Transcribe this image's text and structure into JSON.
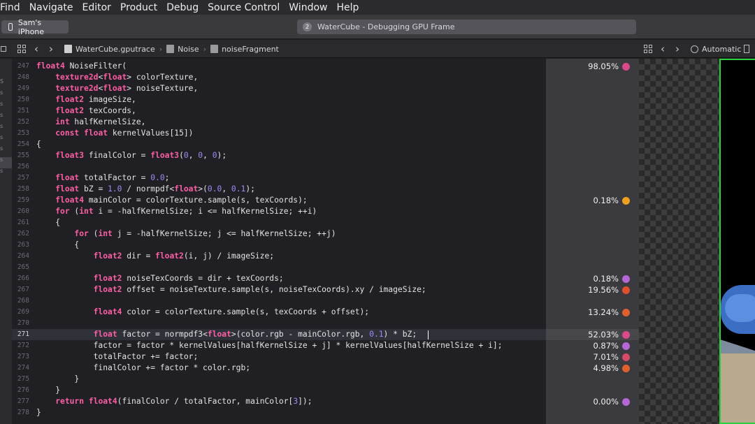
{
  "menu": [
    "Find",
    "Navigate",
    "Editor",
    "Product",
    "Debug",
    "Source Control",
    "Window",
    "Help"
  ],
  "toolbar": {
    "device": "Sam's iPhone",
    "activity_badge": "2",
    "activity_title": "WaterCube - Debugging GPU Frame"
  },
  "jumpbar": {
    "crumbs": [
      "WaterCube.gputrace",
      "Noise",
      "noiseFragment"
    ],
    "right_label": "Automatic"
  },
  "left_strip_letters": [
    "S",
    "s",
    "s",
    "s",
    "s",
    "s",
    "s",
    "s",
    "s"
  ],
  "editor": {
    "current_line": "271",
    "lines": [
      {
        "n": "247",
        "segs": [
          [
            "kw",
            "float4"
          ],
          [
            "t",
            " NoiseFilter("
          ]
        ]
      },
      {
        "n": "248",
        "segs": [
          [
            "t",
            "    "
          ],
          [
            "kw",
            "texture2d"
          ],
          [
            "t",
            "<"
          ],
          [
            "kw",
            "float"
          ],
          [
            "t",
            "> colorTexture,"
          ]
        ]
      },
      {
        "n": "249",
        "segs": [
          [
            "t",
            "    "
          ],
          [
            "kw",
            "texture2d"
          ],
          [
            "t",
            "<"
          ],
          [
            "kw",
            "float"
          ],
          [
            "t",
            "> noiseTexture,"
          ]
        ]
      },
      {
        "n": "250",
        "segs": [
          [
            "t",
            "    "
          ],
          [
            "kw",
            "float2"
          ],
          [
            "t",
            " imageSize,"
          ]
        ]
      },
      {
        "n": "251",
        "segs": [
          [
            "t",
            "    "
          ],
          [
            "kw",
            "float2"
          ],
          [
            "t",
            " texCoords,"
          ]
        ]
      },
      {
        "n": "252",
        "segs": [
          [
            "t",
            "    "
          ],
          [
            "kw",
            "int"
          ],
          [
            "t",
            " halfKernelSize,"
          ]
        ]
      },
      {
        "n": "253",
        "segs": [
          [
            "t",
            "    "
          ],
          [
            "kw",
            "const"
          ],
          [
            "t",
            " "
          ],
          [
            "kw",
            "float"
          ],
          [
            "t",
            " kernelValues[15])"
          ]
        ]
      },
      {
        "n": "254",
        "segs": [
          [
            "t",
            "{"
          ]
        ]
      },
      {
        "n": "255",
        "segs": [
          [
            "t",
            "    "
          ],
          [
            "kw",
            "float3"
          ],
          [
            "t",
            " finalColor = "
          ],
          [
            "kw",
            "float3"
          ],
          [
            "t",
            "("
          ],
          [
            "num",
            "0"
          ],
          [
            "t",
            ", "
          ],
          [
            "num",
            "0"
          ],
          [
            "t",
            ", "
          ],
          [
            "num",
            "0"
          ],
          [
            "t",
            ");"
          ]
        ]
      },
      {
        "n": "256",
        "segs": []
      },
      {
        "n": "257",
        "segs": [
          [
            "t",
            "    "
          ],
          [
            "kw",
            "float"
          ],
          [
            "t",
            " totalFactor = "
          ],
          [
            "num",
            "0.0"
          ],
          [
            "t",
            ";"
          ]
        ]
      },
      {
        "n": "258",
        "segs": [
          [
            "t",
            "    "
          ],
          [
            "kw",
            "float"
          ],
          [
            "t",
            " bZ = "
          ],
          [
            "num",
            "1.0"
          ],
          [
            "t",
            " / normpdf<"
          ],
          [
            "kw",
            "float"
          ],
          [
            "t",
            ">("
          ],
          [
            "num",
            "0.0"
          ],
          [
            "t",
            ", "
          ],
          [
            "num",
            "0.1"
          ],
          [
            "t",
            ");"
          ]
        ]
      },
      {
        "n": "259",
        "segs": [
          [
            "t",
            "    "
          ],
          [
            "kw",
            "float4"
          ],
          [
            "t",
            " mainColor = colorTexture.sample(s, texCoords);"
          ]
        ]
      },
      {
        "n": "260",
        "segs": [
          [
            "t",
            "    "
          ],
          [
            "kw",
            "for"
          ],
          [
            "t",
            " ("
          ],
          [
            "kw",
            "int"
          ],
          [
            "t",
            " i = -halfKernelSize; i <= halfKernelSize; ++i)"
          ]
        ]
      },
      {
        "n": "261",
        "segs": [
          [
            "t",
            "    {"
          ]
        ]
      },
      {
        "n": "262",
        "segs": [
          [
            "t",
            "        "
          ],
          [
            "kw",
            "for"
          ],
          [
            "t",
            " ("
          ],
          [
            "kw",
            "int"
          ],
          [
            "t",
            " j = -halfKernelSize; j <= halfKernelSize; ++j)"
          ]
        ]
      },
      {
        "n": "263",
        "segs": [
          [
            "t",
            "        {"
          ]
        ]
      },
      {
        "n": "264",
        "segs": [
          [
            "t",
            "            "
          ],
          [
            "kw",
            "float2"
          ],
          [
            "t",
            " dir = "
          ],
          [
            "kw",
            "float2"
          ],
          [
            "t",
            "(i, j) / imageSize;"
          ]
        ]
      },
      {
        "n": "265",
        "segs": []
      },
      {
        "n": "266",
        "segs": [
          [
            "t",
            "            "
          ],
          [
            "kw",
            "float2"
          ],
          [
            "t",
            " noiseTexCoords = dir + texCoords;"
          ]
        ]
      },
      {
        "n": "267",
        "segs": [
          [
            "t",
            "            "
          ],
          [
            "kw",
            "float2"
          ],
          [
            "t",
            " offset = noiseTexture.sample(s, noiseTexCoords).xy / imageSize;"
          ]
        ]
      },
      {
        "n": "268",
        "segs": []
      },
      {
        "n": "269",
        "segs": [
          [
            "t",
            "            "
          ],
          [
            "kw",
            "float4"
          ],
          [
            "t",
            " color = colorTexture.sample(s, texCoords + offset);"
          ]
        ]
      },
      {
        "n": "270",
        "segs": []
      },
      {
        "n": "271",
        "segs": [
          [
            "t",
            "            "
          ],
          [
            "kw",
            "float"
          ],
          [
            "t",
            " factor = normpdf3<"
          ],
          [
            "kw",
            "float"
          ],
          [
            "t",
            ">(color.rgb - mainColor.rgb, "
          ],
          [
            "num",
            "0.1"
          ],
          [
            "t",
            ") * bZ;"
          ]
        ]
      },
      {
        "n": "272",
        "segs": [
          [
            "t",
            "            factor = factor * kernelValues[halfKernelSize + j] * kernelValues[halfKernelSize + i];"
          ]
        ]
      },
      {
        "n": "273",
        "segs": [
          [
            "t",
            "            totalFactor += factor;"
          ]
        ]
      },
      {
        "n": "274",
        "segs": [
          [
            "t",
            "            finalColor += factor * color.rgb;"
          ]
        ]
      },
      {
        "n": "275",
        "segs": [
          [
            "t",
            "        }"
          ]
        ]
      },
      {
        "n": "276",
        "segs": [
          [
            "t",
            "    }"
          ]
        ]
      },
      {
        "n": "277",
        "segs": [
          [
            "t",
            "    "
          ],
          [
            "kw",
            "return"
          ],
          [
            "t",
            " "
          ],
          [
            "kw",
            "float4"
          ],
          [
            "t",
            "(finalColor / totalFactor, mainColor["
          ],
          [
            "num",
            "3"
          ],
          [
            "t",
            "]);"
          ]
        ]
      },
      {
        "n": "278",
        "segs": [
          [
            "t",
            "}"
          ]
        ]
      }
    ]
  },
  "metrics": [
    {
      "line": "247",
      "value": "98.05%",
      "color": "#d94a8a"
    },
    {
      "line": "259",
      "value": "0.18%",
      "color": "#f0a020"
    },
    {
      "line": "266",
      "value": "0.18%",
      "color": "#b667d6"
    },
    {
      "line": "267",
      "value": "19.56%",
      "color": "#e0502e"
    },
    {
      "line": "269",
      "value": "13.24%",
      "color": "#e06030"
    },
    {
      "line": "271",
      "value": "52.03%",
      "color": "#d94a8a"
    },
    {
      "line": "272",
      "value": "0.87%",
      "color": "#b667d6"
    },
    {
      "line": "273",
      "value": "7.01%",
      "color": "#d94a6a"
    },
    {
      "line": "274",
      "value": "4.98%",
      "color": "#e06030"
    },
    {
      "line": "277",
      "value": "0.00%",
      "color": "#b667d6"
    }
  ]
}
